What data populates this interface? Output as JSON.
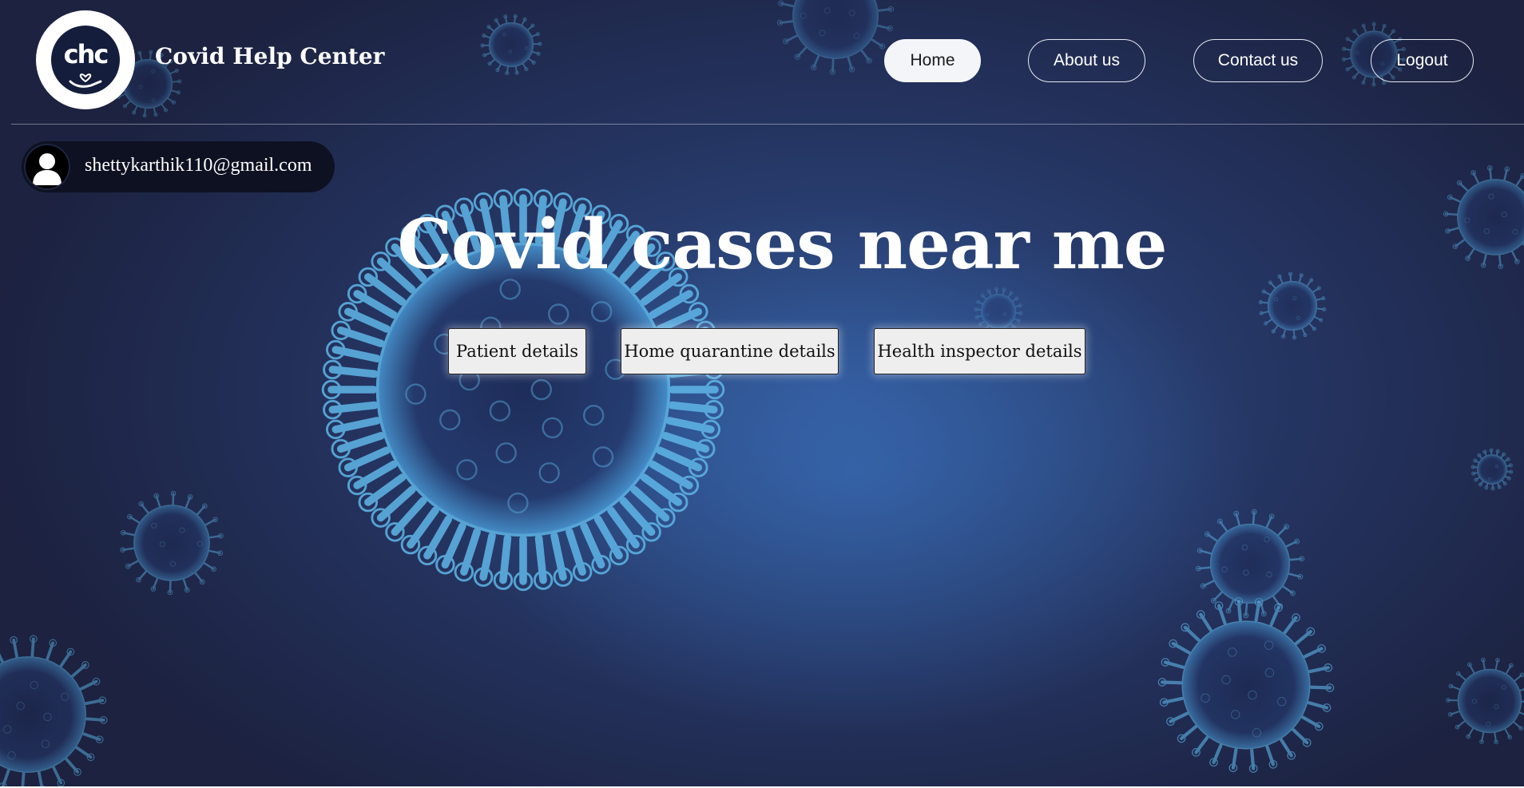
{
  "brand": {
    "logo_text": "chc",
    "name": "Covid Help Center"
  },
  "nav": {
    "items": [
      {
        "label": "Home",
        "active": true
      },
      {
        "label": "About us",
        "active": false
      },
      {
        "label": "Contact us",
        "active": false
      },
      {
        "label": "Logout",
        "active": false
      }
    ]
  },
  "user": {
    "email": "shettykarthik110@gmail.com",
    "avatar_icon": "user-silhouette-icon"
  },
  "hero": {
    "title": "Covid cases near me",
    "buttons": [
      {
        "label": "Patient details"
      },
      {
        "label": "Home quarantine details"
      },
      {
        "label": "Health inspector details"
      }
    ]
  },
  "colors": {
    "background": "#1c2340",
    "accent_glow": "#3c78c8",
    "virus": "#5fb6e8",
    "button_bg": "#eeeeee",
    "nav_active_bg": "#f4f5f9"
  }
}
